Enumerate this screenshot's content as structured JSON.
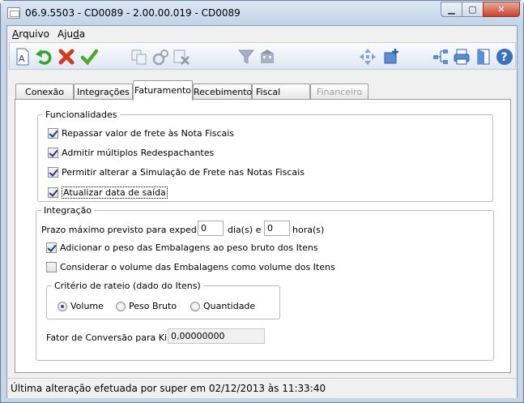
{
  "window": {
    "title": "06.9.5503 - CD0089 - 2.00.00.019 - CD0089"
  },
  "menu": {
    "arquivo_first": "A",
    "arquivo_rest": "rquivo",
    "ajuda_first": "Aju",
    "ajuda_u": "d",
    "ajuda_rest": "a"
  },
  "tabs": [
    "Conexão",
    "Integrações",
    "Faturamento",
    "Recebimento",
    "Fiscal",
    "Financeiro"
  ],
  "funcionalidades": {
    "legend": "Funcionalidades",
    "items": [
      {
        "label": "Repassar valor de frete às Nota Fiscais",
        "checked": true
      },
      {
        "label": "Admitir múltiplos Redespachantes",
        "checked": true
      },
      {
        "label": "Permitir alterar a Simulação de Frete nas Notas Fiscais",
        "checked": true
      },
      {
        "label": "Atualizar data de saída",
        "checked": true
      }
    ]
  },
  "integracao": {
    "legend": "Integração",
    "prazo_label": "Prazo máximo previsto para expedição:",
    "dias_value": "0",
    "dias_unit": "dia(s) e",
    "horas_value": "0",
    "horas_unit": "hora(s)",
    "checks": [
      {
        "label": "Adicionar o peso das Embalagens ao peso bruto dos Itens",
        "checked": true
      },
      {
        "label": "Considerar o volume das Embalagens como volume dos Itens",
        "checked": false
      }
    ],
    "rateio": {
      "legend": "Critério de rateio (dado do Itens)",
      "options": [
        "Volume",
        "Peso Bruto",
        "Quantidade"
      ],
      "selected": "Volume"
    },
    "fator_label": "Fator de Conversão para Kilos:",
    "fator_value": "0,00000000"
  },
  "status": {
    "text": "Última alteração efetuada por super em 02/12/2013 às 11:33:40"
  },
  "colors": {
    "title_bg": "#c3d4e8",
    "close": "#c7432c",
    "check": "#24368a"
  }
}
